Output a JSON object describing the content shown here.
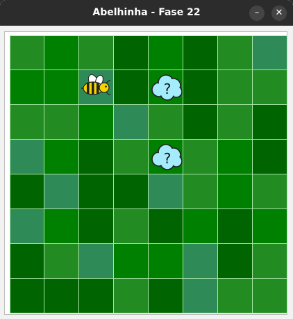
{
  "window": {
    "title": "Abelhinha - Fase 22",
    "minimize_glyph": "–",
    "close_glyph": "✕"
  },
  "board": {
    "cols": 8,
    "rows": 8,
    "colors": {
      "light": "#228b22",
      "mid": "#008000",
      "dark": "#006400",
      "teal": "#2e8b57",
      "grid_line": "#a6e6a6"
    },
    "grid": [
      [
        "light",
        "mid",
        "light",
        "dark",
        "mid",
        "dark",
        "light",
        "teal"
      ],
      [
        "mid",
        "mid",
        "teal",
        "dark",
        "mid",
        "dark",
        "light",
        "light"
      ],
      [
        "light",
        "light",
        "mid",
        "teal",
        "light",
        "dark",
        "light",
        "dark"
      ],
      [
        "teal",
        "mid",
        "dark",
        "light",
        "mid",
        "light",
        "mid",
        "dark"
      ],
      [
        "dark",
        "teal",
        "dark",
        "dark",
        "teal",
        "light",
        "mid",
        "light"
      ],
      [
        "teal",
        "mid",
        "dark",
        "light",
        "dark",
        "mid",
        "dark",
        "mid"
      ],
      [
        "dark",
        "light",
        "teal",
        "mid",
        "mid",
        "teal",
        "dark",
        "light"
      ],
      [
        "dark",
        "dark",
        "dark",
        "light",
        "dark",
        "teal",
        "light",
        "light"
      ]
    ],
    "pieces": [
      {
        "type": "bee",
        "icon": "bee-icon",
        "row": 1,
        "col": 2
      },
      {
        "type": "mystery-cloud",
        "icon": "question-cloud-icon",
        "label": "?",
        "row": 1,
        "col": 4
      },
      {
        "type": "mystery-cloud",
        "icon": "question-cloud-icon",
        "label": "?",
        "row": 3,
        "col": 4
      }
    ]
  }
}
